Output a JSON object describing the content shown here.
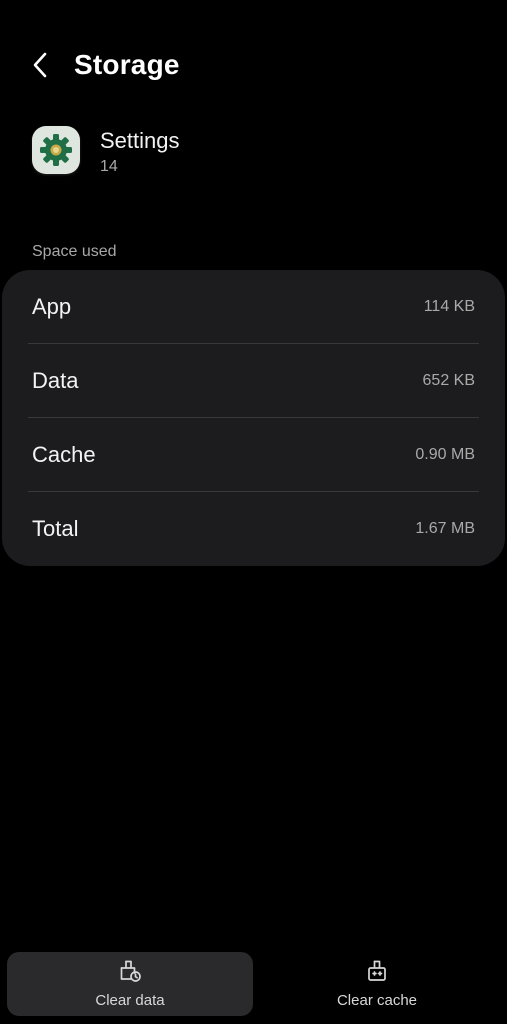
{
  "header": {
    "title": "Storage",
    "back_icon": "chevron-left-icon"
  },
  "app": {
    "name": "Settings",
    "version": "14",
    "icon": "gear-icon"
  },
  "space_used": {
    "label": "Space used",
    "rows": [
      {
        "label": "App",
        "value": "114 KB"
      },
      {
        "label": "Data",
        "value": "652 KB"
      },
      {
        "label": "Cache",
        "value": "0.90 MB"
      },
      {
        "label": "Total",
        "value": "1.67 MB"
      }
    ]
  },
  "actions": {
    "clear_data": {
      "label": "Clear data",
      "icon": "clear-data-icon"
    },
    "clear_cache": {
      "label": "Clear cache",
      "icon": "clear-cache-icon"
    }
  },
  "colors": {
    "background": "#000000",
    "card": "#1c1c1e",
    "icon_green": "#1f6e45",
    "icon_bg": "#dfe6df"
  }
}
